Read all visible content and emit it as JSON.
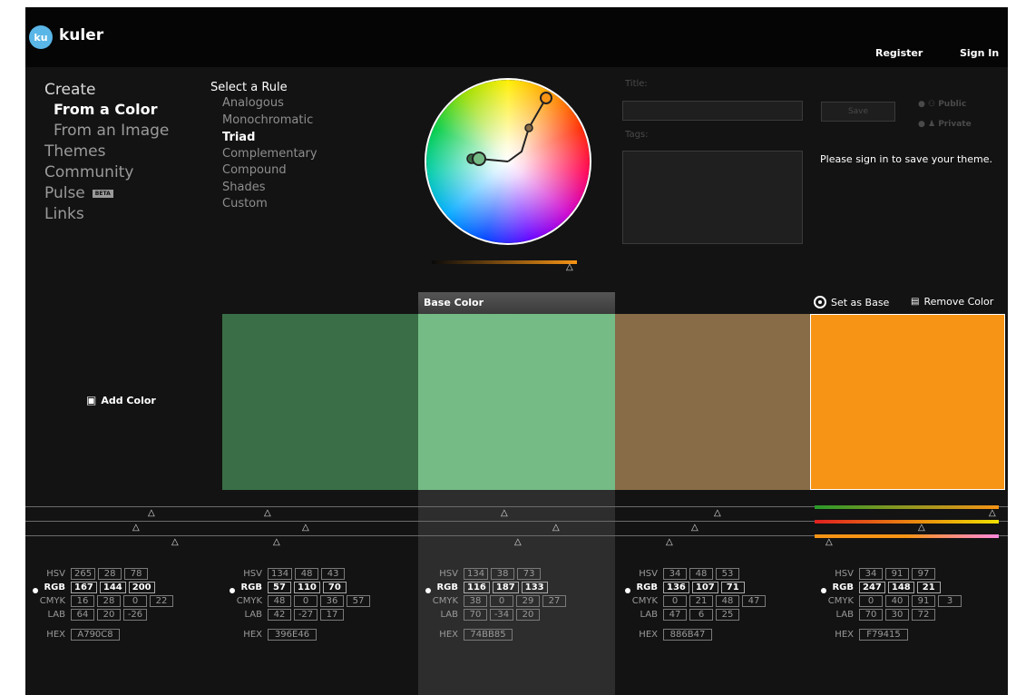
{
  "app": {
    "logo_badge": "ku",
    "logo_text": "kuler"
  },
  "top_nav": {
    "register": "Register",
    "sign_in": "Sign In"
  },
  "side_nav": {
    "create": "Create",
    "from_color": "From a Color",
    "from_image": "From an Image",
    "themes": "Themes",
    "community": "Community",
    "pulse": "Pulse",
    "pulse_badge": "BETA",
    "links": "Links"
  },
  "rules": {
    "title": "Select a Rule",
    "items": [
      "Analogous",
      "Monochromatic",
      "Triad",
      "Complementary",
      "Compound",
      "Shades",
      "Custom"
    ],
    "selected": "Triad"
  },
  "form": {
    "title_label": "Title:",
    "tags_label": "Tags:",
    "save": "Save",
    "public": "Public",
    "private": "Private",
    "signin_message": "Please sign in to save your theme."
  },
  "swatch_bar": {
    "base_color": "Base Color",
    "set_as_base": "Set as Base",
    "remove_color": "Remove Color",
    "add_color": "Add Color"
  },
  "brightness": 1.0,
  "accent_color": "#f79415",
  "labels": {
    "hsv": "HSV",
    "rgb": "RGB",
    "cmyk": "CMYK",
    "lab": "LAB",
    "hex": "HEX"
  },
  "colors": [
    {
      "hex": "A790C8",
      "hsv": [
        "265",
        "28",
        "78"
      ],
      "rgb": [
        "167",
        "144",
        "200"
      ],
      "cmyk": [
        "16",
        "28",
        "0",
        "22"
      ],
      "lab": [
        "64",
        "20",
        "-26"
      ]
    },
    {
      "hex": "396E46",
      "hsv": [
        "134",
        "48",
        "43"
      ],
      "rgb": [
        "57",
        "110",
        "70"
      ],
      "cmyk": [
        "48",
        "0",
        "36",
        "57"
      ],
      "lab": [
        "42",
        "-27",
        "17"
      ]
    },
    {
      "hex": "74BB85",
      "hsv": [
        "134",
        "38",
        "73"
      ],
      "rgb": [
        "116",
        "187",
        "133"
      ],
      "cmyk": [
        "38",
        "0",
        "29",
        "27"
      ],
      "lab": [
        "70",
        "-34",
        "20"
      ]
    },
    {
      "hex": "886B47",
      "hsv": [
        "34",
        "48",
        "53"
      ],
      "rgb": [
        "136",
        "107",
        "71"
      ],
      "cmyk": [
        "0",
        "21",
        "48",
        "47"
      ],
      "lab": [
        "47",
        "6",
        "25"
      ]
    },
    {
      "hex": "F79415",
      "hsv": [
        "34",
        "91",
        "97"
      ],
      "rgb": [
        "247",
        "148",
        "21"
      ],
      "cmyk": [
        "0",
        "40",
        "91",
        "3"
      ],
      "lab": [
        "70",
        "30",
        "72"
      ]
    }
  ]
}
